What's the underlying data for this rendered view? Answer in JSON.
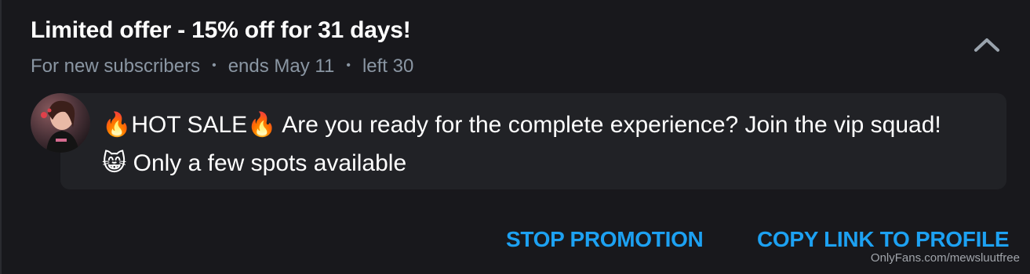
{
  "offer": {
    "title": "Limited offer - 15% off for 31 days!",
    "meta": {
      "audience": "For new subscribers",
      "ends": "ends May 11",
      "left": "left 30",
      "separator": "•"
    }
  },
  "message": {
    "text": "🔥HOT SALE🔥 Are you ready for the complete experience? Join the vip squad! 😸 Only a few spots available"
  },
  "actions": {
    "stop_label": "STOP PROMOTION",
    "copy_label": "COPY LINK TO PROFILE"
  },
  "watermark": "OnlyFans.com/mewsluutfree",
  "colors": {
    "background": "#18181c",
    "bubble": "#212226",
    "accent": "#1da1f2",
    "muted": "#8a96a3"
  },
  "icons": {
    "collapse": "chevron-up-icon"
  }
}
